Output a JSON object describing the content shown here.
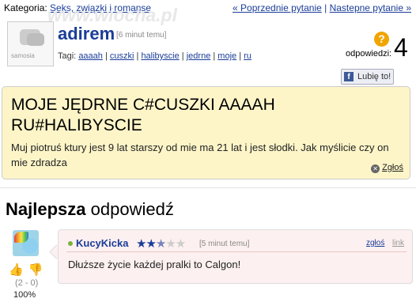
{
  "header": {
    "category_label": "Kategoria:",
    "category_link": "Seks, związki i romanse",
    "prev_link": "« Poprzednie pytanie",
    "separator": "|",
    "next_link": "Nastepne pytanie »",
    "watermark": "www.wiocha.pl"
  },
  "question": {
    "avatar_label": "samosia",
    "author": "adirem",
    "time": "[6 minut temu]",
    "tags_label": "Tagi:",
    "tags": [
      "aaaah",
      "cuszki",
      "halibyscie",
      "jedrne",
      "moje",
      "ru"
    ],
    "answers_label": "odpowiedzi:",
    "answers_count": "4",
    "like_label": "Lubię to!",
    "title": "MOJE JĘDRNE C#CUSZKI AAAAH RU#HALIBYSCIE",
    "body": "Muj piotruś ktury jest 9 lat starszy od mie ma 21 lat i jest słodki. Jak myślicie czy on mie zdradza",
    "report_label": "Zgłoś"
  },
  "best_answer": {
    "heading_bold": "Najlepsza",
    "heading_rest": "odpowiedź",
    "author": "KucyKicka",
    "stars_filled": 2.5,
    "stars_total": 5,
    "time": "[5 minut temu]",
    "report_label": "zgłoś",
    "link_label": "link",
    "text": "Dłuższe życie każdej pralki to Calgon!",
    "score": "(2 - 0)",
    "percent": "100%"
  },
  "colors": {
    "link": "#1a3d99",
    "question_bg": "#fdf5c8",
    "answer_bg": "#fdf0f0"
  }
}
